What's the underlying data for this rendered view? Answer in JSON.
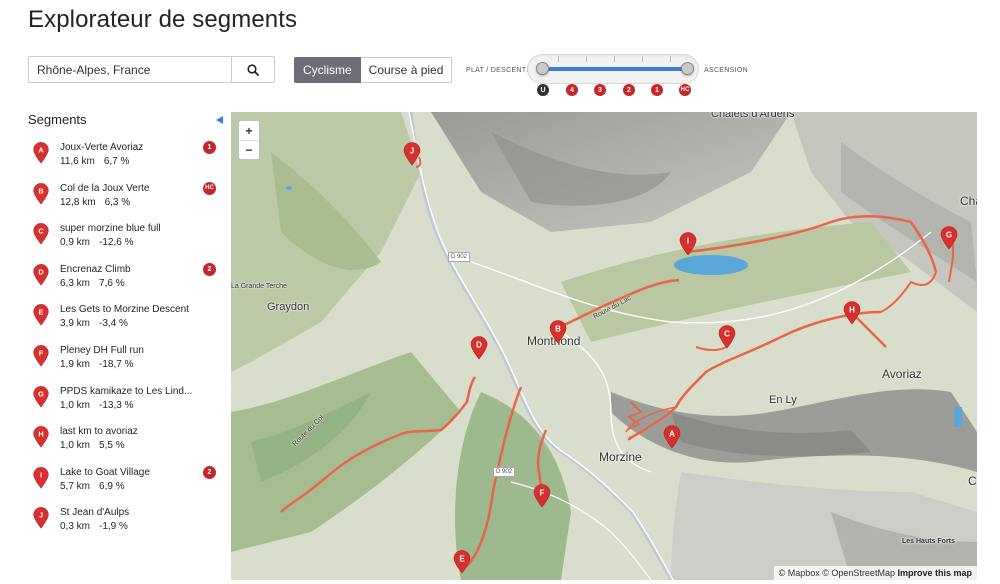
{
  "page": {
    "title": "Explorateur de segments"
  },
  "search": {
    "value": "Rhône-Alpes, France"
  },
  "sport": {
    "options": [
      "Cyclisme",
      "Course à pied"
    ],
    "active": 0
  },
  "slider": {
    "left_label": "PLAT / DESCENTE",
    "right_label": "ASCENSION",
    "categories": [
      {
        "label": "U",
        "color": "#333333"
      },
      {
        "label": "4",
        "color": "#c7252c"
      },
      {
        "label": "3",
        "color": "#c7252c"
      },
      {
        "label": "2",
        "color": "#c7252c"
      },
      {
        "label": "1",
        "color": "#c7252c"
      },
      {
        "label": "HC",
        "color": "#c7252c"
      }
    ]
  },
  "sidebar": {
    "heading": "Segments",
    "segments": [
      {
        "letter": "A",
        "name": "Joux-Verte Avoriaz",
        "distance": "11,6 km",
        "grade": "6,7 %",
        "category": "1"
      },
      {
        "letter": "B",
        "name": "Col de la Joux Verte",
        "distance": "12,8 km",
        "grade": "6,3 %",
        "category": "HC"
      },
      {
        "letter": "C",
        "name": "super morzine blue full",
        "distance": "0,9 km",
        "grade": "-12,6 %",
        "category": ""
      },
      {
        "letter": "D",
        "name": "Encrenaz Climb",
        "distance": "6,3 km",
        "grade": "7,6 %",
        "category": "2"
      },
      {
        "letter": "E",
        "name": "Les Gets to Morzine Descent",
        "distance": "3,9 km",
        "grade": "-3,4 %",
        "category": ""
      },
      {
        "letter": "F",
        "name": "Pleney DH Full run",
        "distance": "1,9 km",
        "grade": "-18,7 %",
        "category": ""
      },
      {
        "letter": "G",
        "name": "PPDS kamikaze to Les Lind...",
        "distance": "1,0 km",
        "grade": "-13,3 %",
        "category": ""
      },
      {
        "letter": "H",
        "name": "last km to avoriaz",
        "distance": "1,0 km",
        "grade": "5,5 %",
        "category": ""
      },
      {
        "letter": "I",
        "name": "Lake to Goat Village",
        "distance": "5,7 km",
        "grade": "6,9 %",
        "category": "2"
      },
      {
        "letter": "J",
        "name": "St Jean d'Aulps",
        "distance": "0,3 km",
        "grade": "-1,9 %",
        "category": ""
      }
    ]
  },
  "map": {
    "zoom_in": "+",
    "zoom_out": "−",
    "places": {
      "montriond": "Montriond",
      "morzine": "Morzine",
      "avoriaz": "Avoriaz",
      "graydon": "Graydon",
      "en_ly": "En Ly",
      "grande_terche": "La Grande Terche",
      "hauts_forts": "Les Hauts Forts",
      "chalets": "Chalets d'Ardens",
      "route_du_lac": "Route du Lac",
      "route_du_col": "Route du Col",
      "cha": "Cha",
      "c_edge": "C"
    },
    "roads": {
      "d902": "D 902"
    },
    "attribution": {
      "mapbox": "© Mapbox",
      "osm": "© OpenStreetMap",
      "improve": "Improve this map"
    },
    "route_color": "#e8654a",
    "marker_color": "#d8302f"
  }
}
